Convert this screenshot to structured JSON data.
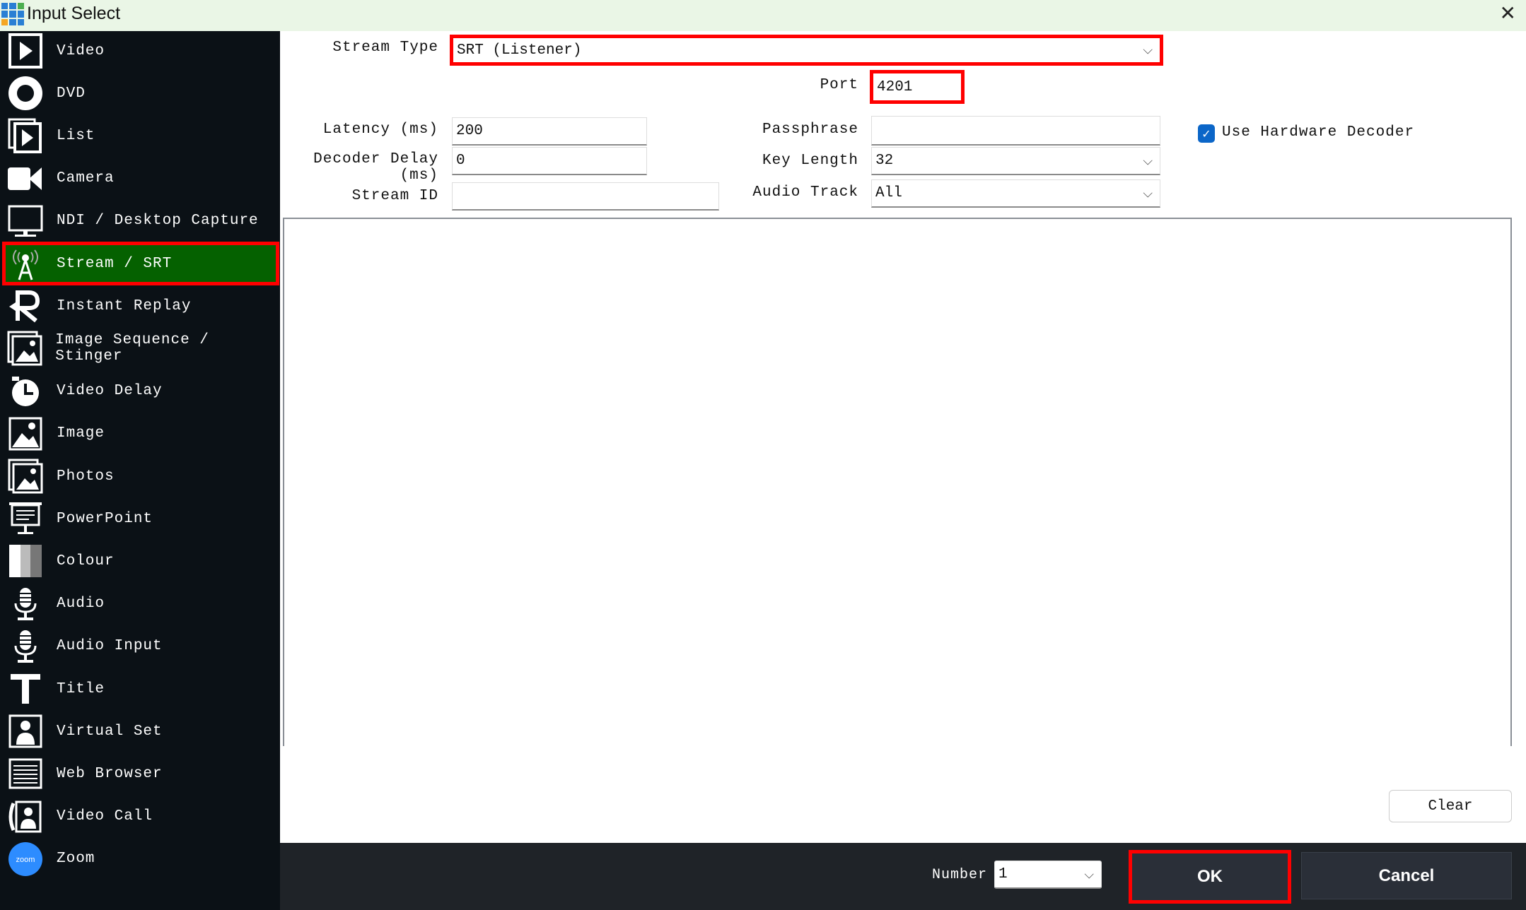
{
  "window": {
    "title": "Input Select",
    "close_icon": "close-icon"
  },
  "sidebar": {
    "items": [
      {
        "label": "Video",
        "icon": "video-icon"
      },
      {
        "label": "DVD",
        "icon": "dvd-icon"
      },
      {
        "label": "List",
        "icon": "list-icon"
      },
      {
        "label": "Camera",
        "icon": "camera-icon"
      },
      {
        "label": "NDI / Desktop Capture",
        "icon": "monitor-icon"
      },
      {
        "label": "Stream / SRT",
        "icon": "antenna-icon",
        "selected": true
      },
      {
        "label": "Instant Replay",
        "icon": "replay-icon"
      },
      {
        "label": "Image Sequence / Stinger",
        "icon": "image-sequence-icon"
      },
      {
        "label": "Video Delay",
        "icon": "clock-icon"
      },
      {
        "label": "Image",
        "icon": "image-icon"
      },
      {
        "label": "Photos",
        "icon": "photos-icon"
      },
      {
        "label": "PowerPoint",
        "icon": "presentation-icon"
      },
      {
        "label": "Colour",
        "icon": "colour-icon"
      },
      {
        "label": "Audio",
        "icon": "microphone-icon"
      },
      {
        "label": "Audio Input",
        "icon": "microphone-icon"
      },
      {
        "label": "Title",
        "icon": "title-icon"
      },
      {
        "label": "Virtual Set",
        "icon": "virtual-set-icon"
      },
      {
        "label": "Web Browser",
        "icon": "web-browser-icon"
      },
      {
        "label": "Video Call",
        "icon": "video-call-icon"
      },
      {
        "label": "Zoom",
        "icon": "zoom-icon",
        "icon_text": "zoom"
      }
    ]
  },
  "form": {
    "stream_type": {
      "label": "Stream Type",
      "value": "SRT (Listener)"
    },
    "port": {
      "label": "Port",
      "value": "4201"
    },
    "latency": {
      "label": "Latency (ms)",
      "value": "200"
    },
    "decoder_delay": {
      "label": "Decoder Delay (ms)",
      "value": "0"
    },
    "stream_id": {
      "label": "Stream ID",
      "value": ""
    },
    "passphrase": {
      "label": "Passphrase",
      "value": ""
    },
    "key_length": {
      "label": "Key Length",
      "value": "32"
    },
    "audio_track": {
      "label": "Audio Track",
      "value": "All"
    },
    "hardware_decoder": {
      "label": "Use Hardware Decoder",
      "checked": true
    }
  },
  "clear_label": "Clear",
  "footer": {
    "number_label": "Number",
    "number_value": "1",
    "ok_label": "OK",
    "cancel_label": "Cancel"
  },
  "colors": {
    "selected_bg": "#056100",
    "highlight": "#ff0000",
    "sidebar_bg": "#0b1116",
    "footer_bg": "#1f2328",
    "checkbox": "#0b66c8"
  }
}
